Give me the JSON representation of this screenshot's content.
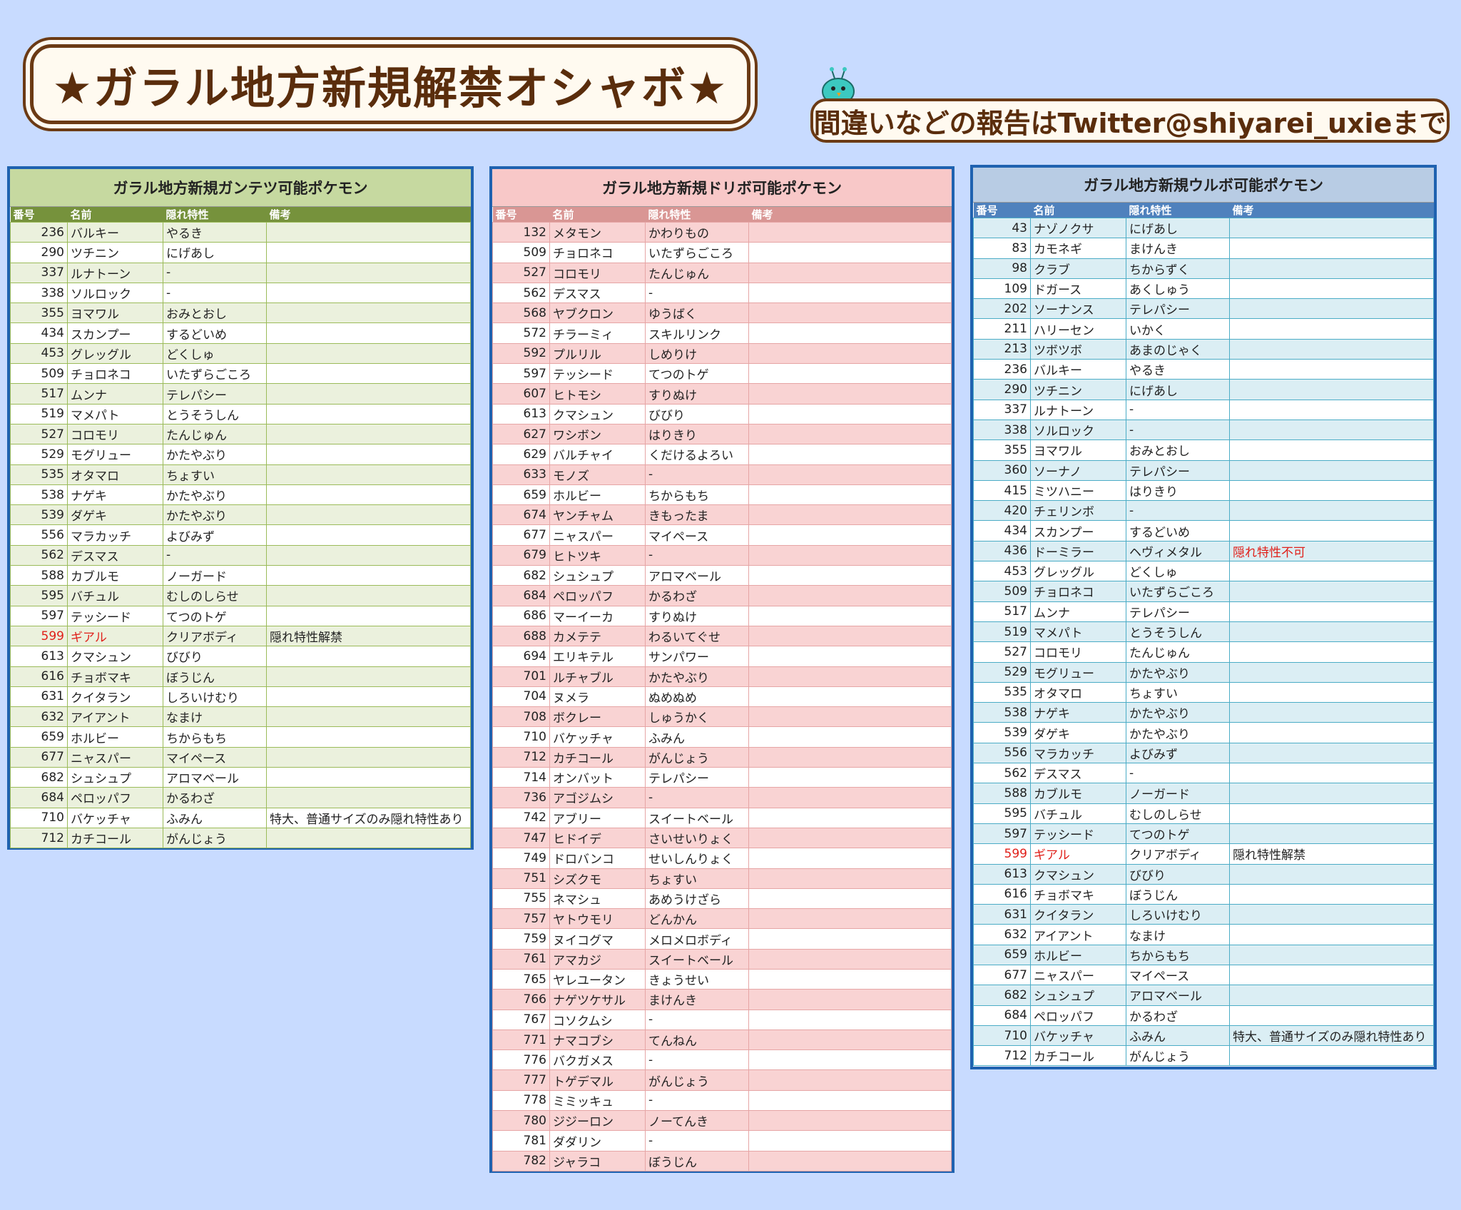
{
  "header": {
    "title": "★ガラル地方新規解禁オシャボ★",
    "report": "間違いなどの報告はTwitter@shiyarei_uxieまで"
  },
  "columns": {
    "num": "番号",
    "name": "名前",
    "ability": "隠れ特性",
    "note": "備考"
  },
  "colors": {
    "green": "#76923c",
    "pink": "#d99694",
    "blue": "#4f81bd",
    "highlight": "#e0201a"
  },
  "panels": [
    {
      "title": "ガラル地方新規ガンテツ可能ポケモン",
      "rows": [
        [
          "236",
          "バルキー",
          "やるき",
          ""
        ],
        [
          "290",
          "ツチニン",
          "にげあし",
          ""
        ],
        [
          "337",
          "ルナトーン",
          "-",
          ""
        ],
        [
          "338",
          "ソルロック",
          "-",
          ""
        ],
        [
          "355",
          "ヨマワル",
          "おみとおし",
          ""
        ],
        [
          "434",
          "スカンプー",
          "するどいめ",
          ""
        ],
        [
          "453",
          "グレッグル",
          "どくしゅ",
          ""
        ],
        [
          "509",
          "チョロネコ",
          "いたずらごころ",
          ""
        ],
        [
          "517",
          "ムンナ",
          "テレパシー",
          ""
        ],
        [
          "519",
          "マメパト",
          "とうそうしん",
          ""
        ],
        [
          "527",
          "コロモリ",
          "たんじゅん",
          ""
        ],
        [
          "529",
          "モグリュー",
          "かたやぶり",
          ""
        ],
        [
          "535",
          "オタマロ",
          "ちょすい",
          ""
        ],
        [
          "538",
          "ナゲキ",
          "かたやぶり",
          ""
        ],
        [
          "539",
          "ダゲキ",
          "かたやぶり",
          ""
        ],
        [
          "556",
          "マラカッチ",
          "よびみず",
          ""
        ],
        [
          "562",
          "デスマス",
          "-",
          ""
        ],
        [
          "588",
          "カブルモ",
          "ノーガード",
          ""
        ],
        [
          "595",
          "バチュル",
          "むしのしらせ",
          ""
        ],
        [
          "597",
          "テッシード",
          "てつのトゲ",
          ""
        ],
        [
          "599",
          "ギアル",
          "クリアボディ",
          "隠れ特性解禁"
        ],
        [
          "613",
          "クマシュン",
          "びびり",
          ""
        ],
        [
          "616",
          "チョボマキ",
          "ぼうじん",
          ""
        ],
        [
          "631",
          "クイタラン",
          "しろいけむり",
          ""
        ],
        [
          "632",
          "アイアント",
          "なまけ",
          ""
        ],
        [
          "659",
          "ホルビー",
          "ちからもち",
          ""
        ],
        [
          "677",
          "ニャスパー",
          "マイペース",
          ""
        ],
        [
          "682",
          "シュシュプ",
          "アロマベール",
          ""
        ],
        [
          "684",
          "ペロッパフ",
          "かるわざ",
          ""
        ],
        [
          "710",
          "バケッチャ",
          "ふみん",
          "特大、普通サイズのみ隠れ特性あり"
        ],
        [
          "712",
          "カチコール",
          "がんじょう",
          ""
        ]
      ]
    },
    {
      "title": "ガラル地方新規ドリボ可能ポケモン",
      "rows": [
        [
          "132",
          "メタモン",
          "かわりもの",
          ""
        ],
        [
          "509",
          "チョロネコ",
          "いたずらごころ",
          ""
        ],
        [
          "527",
          "コロモリ",
          "たんじゅん",
          ""
        ],
        [
          "562",
          "デスマス",
          "-",
          ""
        ],
        [
          "568",
          "ヤブクロン",
          "ゆうばく",
          ""
        ],
        [
          "572",
          "チラーミィ",
          "スキルリンク",
          ""
        ],
        [
          "592",
          "プルリル",
          "しめりけ",
          ""
        ],
        [
          "597",
          "テッシード",
          "てつのトゲ",
          ""
        ],
        [
          "607",
          "ヒトモシ",
          "すりぬけ",
          ""
        ],
        [
          "613",
          "クマシュン",
          "びびり",
          ""
        ],
        [
          "627",
          "ワシボン",
          "はりきり",
          ""
        ],
        [
          "629",
          "バルチャイ",
          "くだけるよろい",
          ""
        ],
        [
          "633",
          "モノズ",
          "-",
          ""
        ],
        [
          "659",
          "ホルビー",
          "ちからもち",
          ""
        ],
        [
          "674",
          "ヤンチャム",
          "きもったま",
          ""
        ],
        [
          "677",
          "ニャスパー",
          "マイペース",
          ""
        ],
        [
          "679",
          "ヒトツキ",
          "-",
          ""
        ],
        [
          "682",
          "シュシュプ",
          "アロマベール",
          ""
        ],
        [
          "684",
          "ペロッパフ",
          "かるわざ",
          ""
        ],
        [
          "686",
          "マーイーカ",
          "すりぬけ",
          ""
        ],
        [
          "688",
          "カメテテ",
          "わるいてぐせ",
          ""
        ],
        [
          "694",
          "エリキテル",
          "サンパワー",
          ""
        ],
        [
          "701",
          "ルチャブル",
          "かたやぶり",
          ""
        ],
        [
          "704",
          "ヌメラ",
          "ぬめぬめ",
          ""
        ],
        [
          "708",
          "ボクレー",
          "しゅうかく",
          ""
        ],
        [
          "710",
          "バケッチャ",
          "ふみん",
          ""
        ],
        [
          "712",
          "カチコール",
          "がんじょう",
          ""
        ],
        [
          "714",
          "オンバット",
          "テレパシー",
          ""
        ],
        [
          "736",
          "アゴジムシ",
          "-",
          ""
        ],
        [
          "742",
          "アブリー",
          "スイートベール",
          ""
        ],
        [
          "747",
          "ヒドイデ",
          "さいせいりょく",
          ""
        ],
        [
          "749",
          "ドロバンコ",
          "せいしんりょく",
          ""
        ],
        [
          "751",
          "シズクモ",
          "ちょすい",
          ""
        ],
        [
          "755",
          "ネマシュ",
          "あめうけざら",
          ""
        ],
        [
          "757",
          "ヤトウモリ",
          "どんかん",
          ""
        ],
        [
          "759",
          "ヌイコグマ",
          "メロメロボディ",
          ""
        ],
        [
          "761",
          "アマカジ",
          "スイートベール",
          ""
        ],
        [
          "765",
          "ヤレユータン",
          "きょうせい",
          ""
        ],
        [
          "766",
          "ナゲツケサル",
          "まけんき",
          ""
        ],
        [
          "767",
          "コソクムシ",
          "-",
          ""
        ],
        [
          "771",
          "ナマコブシ",
          "てんねん",
          ""
        ],
        [
          "776",
          "バクガメス",
          "-",
          ""
        ],
        [
          "777",
          "トゲデマル",
          "がんじょう",
          ""
        ],
        [
          "778",
          "ミミッキュ",
          "-",
          ""
        ],
        [
          "780",
          "ジジーロン",
          "ノーてんき",
          ""
        ],
        [
          "781",
          "ダダリン",
          "-",
          ""
        ],
        [
          "782",
          "ジャラコ",
          "ぼうじん",
          ""
        ]
      ]
    },
    {
      "title": "ガラル地方新規ウルボ可能ポケモン",
      "rows": [
        [
          "43",
          "ナゾノクサ",
          "にげあし",
          ""
        ],
        [
          "83",
          "カモネギ",
          "まけんき",
          ""
        ],
        [
          "98",
          "クラブ",
          "ちからずく",
          ""
        ],
        [
          "109",
          "ドガース",
          "あくしゅう",
          ""
        ],
        [
          "202",
          "ソーナンス",
          "テレパシー",
          ""
        ],
        [
          "211",
          "ハリーセン",
          "いかく",
          ""
        ],
        [
          "213",
          "ツボツボ",
          "あまのじゃく",
          ""
        ],
        [
          "236",
          "バルキー",
          "やるき",
          ""
        ],
        [
          "290",
          "ツチニン",
          "にげあし",
          ""
        ],
        [
          "337",
          "ルナトーン",
          "-",
          ""
        ],
        [
          "338",
          "ソルロック",
          "-",
          ""
        ],
        [
          "355",
          "ヨマワル",
          "おみとおし",
          ""
        ],
        [
          "360",
          "ソーナノ",
          "テレパシー",
          ""
        ],
        [
          "415",
          "ミツハニー",
          "はりきり",
          ""
        ],
        [
          "420",
          "チェリンボ",
          "-",
          ""
        ],
        [
          "434",
          "スカンプー",
          "するどいめ",
          ""
        ],
        [
          "436",
          "ドーミラー",
          "ヘヴィメタル",
          "隠れ特性不可"
        ],
        [
          "453",
          "グレッグル",
          "どくしゅ",
          ""
        ],
        [
          "509",
          "チョロネコ",
          "いたずらごころ",
          ""
        ],
        [
          "517",
          "ムンナ",
          "テレパシー",
          ""
        ],
        [
          "519",
          "マメパト",
          "とうそうしん",
          ""
        ],
        [
          "527",
          "コロモリ",
          "たんじゅん",
          ""
        ],
        [
          "529",
          "モグリュー",
          "かたやぶり",
          ""
        ],
        [
          "535",
          "オタマロ",
          "ちょすい",
          ""
        ],
        [
          "538",
          "ナゲキ",
          "かたやぶり",
          ""
        ],
        [
          "539",
          "ダゲキ",
          "かたやぶり",
          ""
        ],
        [
          "556",
          "マラカッチ",
          "よびみず",
          ""
        ],
        [
          "562",
          "デスマス",
          "-",
          ""
        ],
        [
          "588",
          "カブルモ",
          "ノーガード",
          ""
        ],
        [
          "595",
          "バチュル",
          "むしのしらせ",
          ""
        ],
        [
          "597",
          "テッシード",
          "てつのトゲ",
          ""
        ],
        [
          "599",
          "ギアル",
          "クリアボディ",
          "隠れ特性解禁"
        ],
        [
          "613",
          "クマシュン",
          "びびり",
          ""
        ],
        [
          "616",
          "チョボマキ",
          "ぼうじん",
          ""
        ],
        [
          "631",
          "クイタラン",
          "しろいけむり",
          ""
        ],
        [
          "632",
          "アイアント",
          "なまけ",
          ""
        ],
        [
          "659",
          "ホルビー",
          "ちからもち",
          ""
        ],
        [
          "677",
          "ニャスパー",
          "マイペース",
          ""
        ],
        [
          "682",
          "シュシュプ",
          "アロマベール",
          ""
        ],
        [
          "684",
          "ペロッパフ",
          "かるわざ",
          ""
        ],
        [
          "710",
          "バケッチャ",
          "ふみん",
          "特大、普通サイズのみ隠れ特性あり"
        ],
        [
          "712",
          "カチコール",
          "がんじょう",
          ""
        ]
      ]
    }
  ],
  "highlights": {
    "0": [
      20,
      29
    ],
    "1": [],
    "2": [
      16,
      31,
      40
    ]
  },
  "red_rows": {
    "0": [
      20
    ],
    "1": [],
    "2": [
      31
    ]
  },
  "red_notes": {
    "2": [
      16
    ]
  }
}
